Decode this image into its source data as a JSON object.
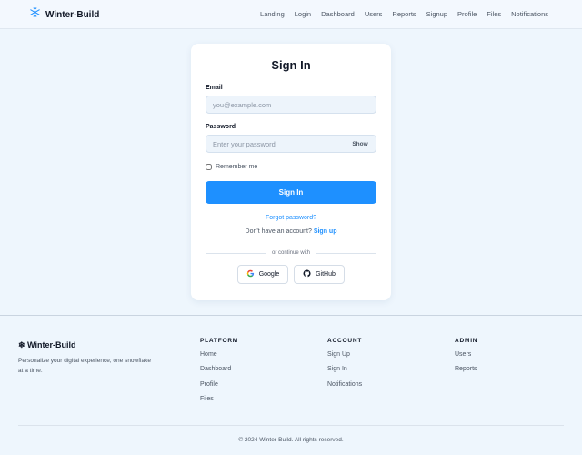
{
  "header": {
    "brand": "Winter-Build",
    "brand_icon": "snowflake-icon",
    "nav": [
      "Landing",
      "Login",
      "Dashboard",
      "Users",
      "Reports",
      "Signup",
      "Profile",
      "Files",
      "Notifications"
    ]
  },
  "login": {
    "title": "Sign In",
    "email_label": "Email",
    "email_placeholder": "you@example.com",
    "email_value": "",
    "password_label": "Password",
    "password_placeholder": "Enter your password",
    "password_value": "",
    "show_label": "Show",
    "remember_label": "Remember me",
    "remember_checked": false,
    "submit_label": "Sign In",
    "forgot_label": "Forgot password?",
    "no_account_text": "Don't have an account?",
    "signup_label": "Sign up",
    "divider_text": "or continue with",
    "google_label": "Google",
    "github_label": "GitHub"
  },
  "footer": {
    "brand": "❄ Winter-Build",
    "tagline": "Personalize your digital experience, one snowflake at a time.",
    "columns": [
      {
        "heading": "PLATFORM",
        "links": [
          "Home",
          "Dashboard",
          "Profile",
          "Files"
        ]
      },
      {
        "heading": "ACCOUNT",
        "links": [
          "Sign Up",
          "Sign In",
          "Notifications"
        ]
      },
      {
        "heading": "ADMIN",
        "links": [
          "Users",
          "Reports"
        ]
      }
    ],
    "copyright": "© 2024 Winter-Build. All rights reserved."
  },
  "colors": {
    "accent": "#1e90ff",
    "background": "#eef6fd",
    "card": "#ffffff"
  }
}
